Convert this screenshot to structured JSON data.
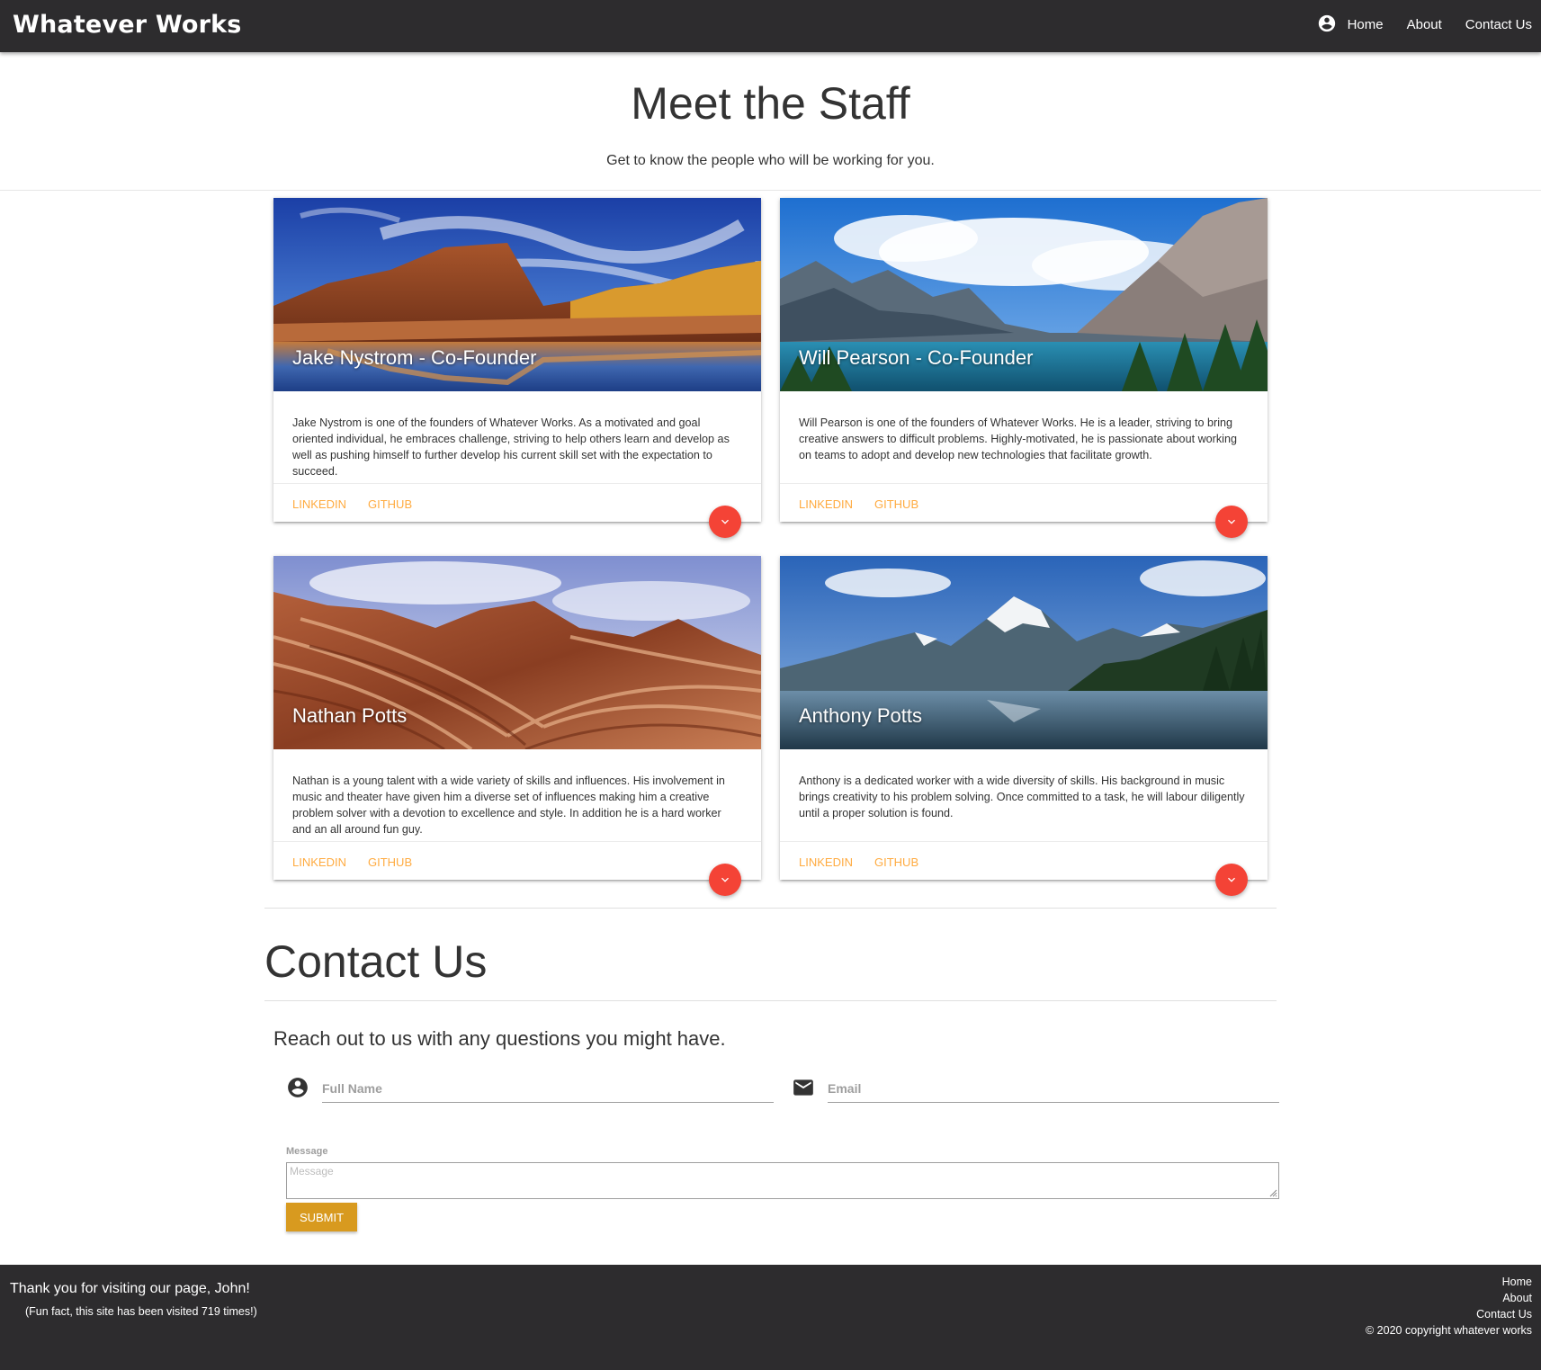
{
  "navbar": {
    "brand": "Whatever Works",
    "links": [
      "Home",
      "About",
      "Contact Us"
    ]
  },
  "hero": {
    "title": "Meet the Staff",
    "subtitle": "Get to know the people who will be working for you."
  },
  "staff": [
    {
      "name": "Jake Nystrom - Co-Founder",
      "bio": "Jake Nystrom is one of the founders of Whatever Works. As a motivated and goal oriented individual, he embraces challenge, striving to help others learn and develop as well as pushing himself to further develop his current skill set with the expectation to succeed.",
      "links": [
        "LINKEDIN",
        "GITHUB"
      ],
      "image": "canyon-lake-landscape"
    },
    {
      "name": "Will Pearson - Co-Founder",
      "bio": "Will Pearson is one of the founders of Whatever Works. He is a leader, striving to bring creative answers to difficult problems. Highly-motivated, he is passionate about working on teams to adopt and develop new technologies that facilitate growth.",
      "links": [
        "LINKEDIN",
        "GITHUB"
      ],
      "image": "mountain-lake-landscape"
    },
    {
      "name": "Nathan Potts",
      "bio": "Nathan is a young talent with a wide variety of skills and influences. His involvement in music and theater have given him a diverse set of influences making him a creative problem solver with a devotion to excellence and style. In addition he is a hard worker and an all around fun guy.",
      "links": [
        "LINKEDIN",
        "GITHUB"
      ],
      "image": "sandstone-wave-landscape"
    },
    {
      "name": "Anthony Potts",
      "bio": "Anthony is a dedicated worker with a wide diversity of skills. His background in music brings creativity to his problem solving. Once committed to a task, he will labour diligently until a proper solution is found.",
      "links": [
        "LINKEDIN",
        "GITHUB"
      ],
      "image": "snowy-mountain-reflection-landscape"
    }
  ],
  "contact": {
    "title": "Contact Us",
    "subtitle": "Reach out to us with any questions you might have.",
    "full_name_placeholder": "Full Name",
    "email_placeholder": "Email",
    "message_label": "Message",
    "message_placeholder": "Message",
    "submit_label": "SUBMIT"
  },
  "footer": {
    "thanks": "Thank you for visiting our page, John!",
    "fun_fact": "(Fun fact, this site has been visited 719 times!)",
    "links": [
      "Home",
      "About",
      "Contact Us"
    ],
    "copyright": "© 2020 copyright whatever works"
  },
  "colors": {
    "navbar_bg": "#2d2c2e",
    "card_link": "#ffab40",
    "fab": "#f44336",
    "submit_button": "#d89a1f"
  },
  "icons": [
    "account-circle-icon",
    "email-icon",
    "chevron-down-icon"
  ]
}
